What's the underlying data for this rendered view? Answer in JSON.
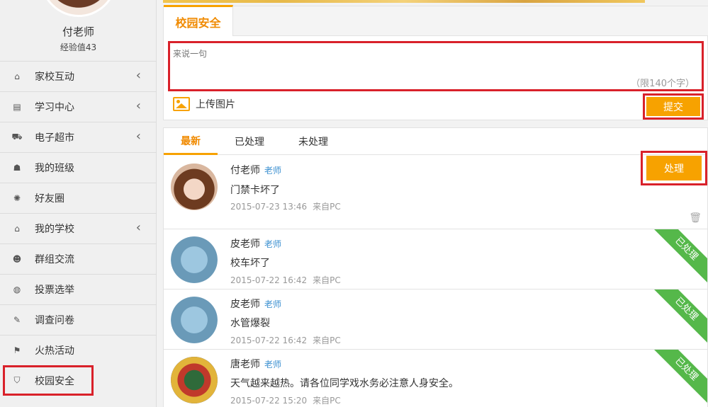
{
  "user": {
    "name": "付老师",
    "exp": "经验值43"
  },
  "sidebar": {
    "items": [
      {
        "label": "家校互动",
        "icon": "home-icon",
        "chevron": true
      },
      {
        "label": "学习中心",
        "icon": "book-icon",
        "chevron": true
      },
      {
        "label": "电子超市",
        "icon": "cart-icon",
        "chevron": true
      },
      {
        "label": "我的班级",
        "icon": "group-icon",
        "chevron": false
      },
      {
        "label": "好友圈",
        "icon": "aperture-icon",
        "chevron": false
      },
      {
        "label": "我的学校",
        "icon": "bank-icon",
        "chevron": true
      },
      {
        "label": "群组交流",
        "icon": "users-icon",
        "chevron": false
      },
      {
        "label": "投票选举",
        "icon": "vote-icon",
        "chevron": false
      },
      {
        "label": "调查问卷",
        "icon": "edit-icon",
        "chevron": false
      },
      {
        "label": "火热活动",
        "icon": "flag-icon",
        "chevron": false
      },
      {
        "label": "校园安全",
        "icon": "shield-icon",
        "chevron": false
      }
    ]
  },
  "panel": {
    "tab": "校园安全",
    "placeholder": "来说一句",
    "limit": "（限140个字）",
    "upload": "上传图片",
    "submit": "提交"
  },
  "list": {
    "tabs": [
      "最新",
      "已处理",
      "未处理"
    ],
    "handle_label": "处理",
    "processed_label": "已处理",
    "items": [
      {
        "name": "付老师",
        "role": "老师",
        "text": "门禁卡坏了",
        "time": "2015-07-23 13:46",
        "source": "来自PC",
        "avatar": "girl",
        "status": "pending"
      },
      {
        "name": "皮老师",
        "role": "老师",
        "text": "校车坏了",
        "time": "2015-07-22 16:42",
        "source": "来自PC",
        "avatar": "map",
        "status": "processed"
      },
      {
        "name": "皮老师",
        "role": "老师",
        "text": "水管爆裂",
        "time": "2015-07-22 16:42",
        "source": "来自PC",
        "avatar": "map",
        "status": "processed"
      },
      {
        "name": "唐老师",
        "role": "老师",
        "text": "天气越来越热。请各位同学戏水务必注意人身安全。",
        "time": "2015-07-22 15:20",
        "source": "来自PC",
        "avatar": "lego",
        "status": "processed"
      }
    ]
  },
  "colors": {
    "accent": "#f7a200",
    "highlight": "#d9212a",
    "processed": "#55b84a",
    "role": "#3a8fd0"
  }
}
